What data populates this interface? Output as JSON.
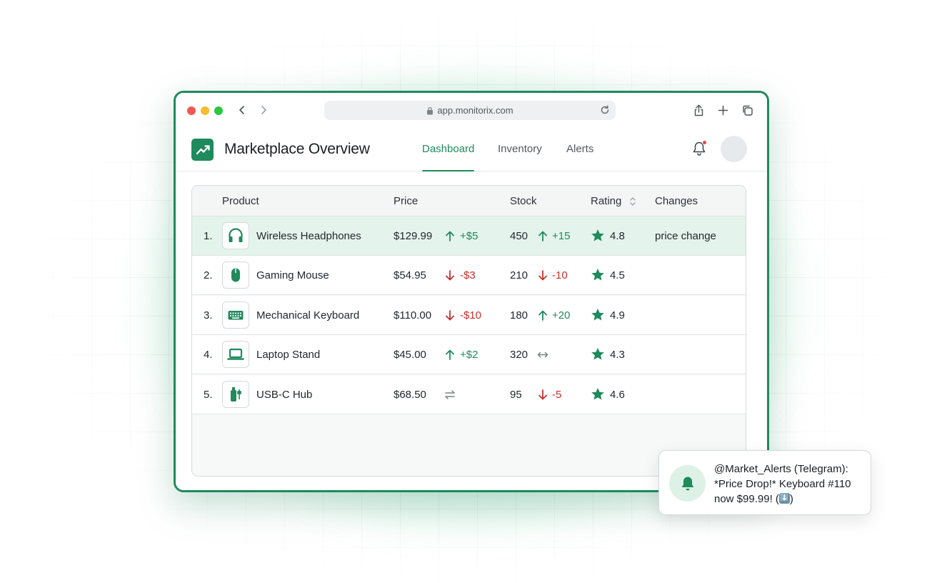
{
  "browser": {
    "url": "app.monitorix.com"
  },
  "header": {
    "title": "Marketplace Overview",
    "tabs": [
      {
        "label": "Dashboard",
        "active": true
      },
      {
        "label": "Inventory",
        "active": false
      },
      {
        "label": "Alerts",
        "active": false
      }
    ],
    "notification_dot": true
  },
  "table": {
    "columns": [
      "Product",
      "Price",
      "Stock",
      "Rating",
      "Changes"
    ],
    "rows": [
      {
        "rank": "1.",
        "icon": "headphones-icon",
        "product": "Wireless Headphones",
        "price": "$129.99",
        "price_trend": "up",
        "price_delta": "+$5",
        "stock": "450",
        "stock_trend": "up",
        "stock_delta": "+15",
        "rating": "4.8",
        "changes": "price change",
        "highlighted": true
      },
      {
        "rank": "2.",
        "icon": "mouse-icon",
        "product": "Gaming Mouse",
        "price": "$54.95",
        "price_trend": "down",
        "price_delta": "-$3",
        "stock": "210",
        "stock_trend": "down",
        "stock_delta": "-10",
        "rating": "4.5",
        "changes": ""
      },
      {
        "rank": "3.",
        "icon": "keyboard-icon",
        "product": "Mechanical Keyboard",
        "price": "$110.00",
        "price_trend": "down",
        "price_delta": "-$10",
        "stock": "180",
        "stock_trend": "up",
        "stock_delta": "+20",
        "rating": "4.9",
        "changes": ""
      },
      {
        "rank": "4.",
        "icon": "laptop-icon",
        "product": "Laptop Stand",
        "price": "$45.00",
        "price_trend": "up",
        "price_delta": "+$2",
        "stock": "320",
        "stock_trend": "flat",
        "stock_delta": "",
        "rating": "4.3",
        "changes": ""
      },
      {
        "rank": "5.",
        "icon": "usb-hub-icon",
        "product": "USB-C Hub",
        "price": "$68.50",
        "price_trend": "flat",
        "price_delta": "",
        "stock": "95",
        "stock_trend": "down",
        "stock_delta": "-5",
        "rating": "4.6",
        "changes": ""
      }
    ]
  },
  "toast": {
    "title": "@Market_Alerts (Telegram):",
    "message": "*Price Drop!* Keyboard #110 now $99.99! (",
    "emoji": "⬇️",
    "message_end": ")"
  },
  "colors": {
    "accent": "#1f8a5c",
    "up": "#1f8a5c",
    "down": "#c9302c",
    "highlight_row": "#e4f4ec"
  }
}
